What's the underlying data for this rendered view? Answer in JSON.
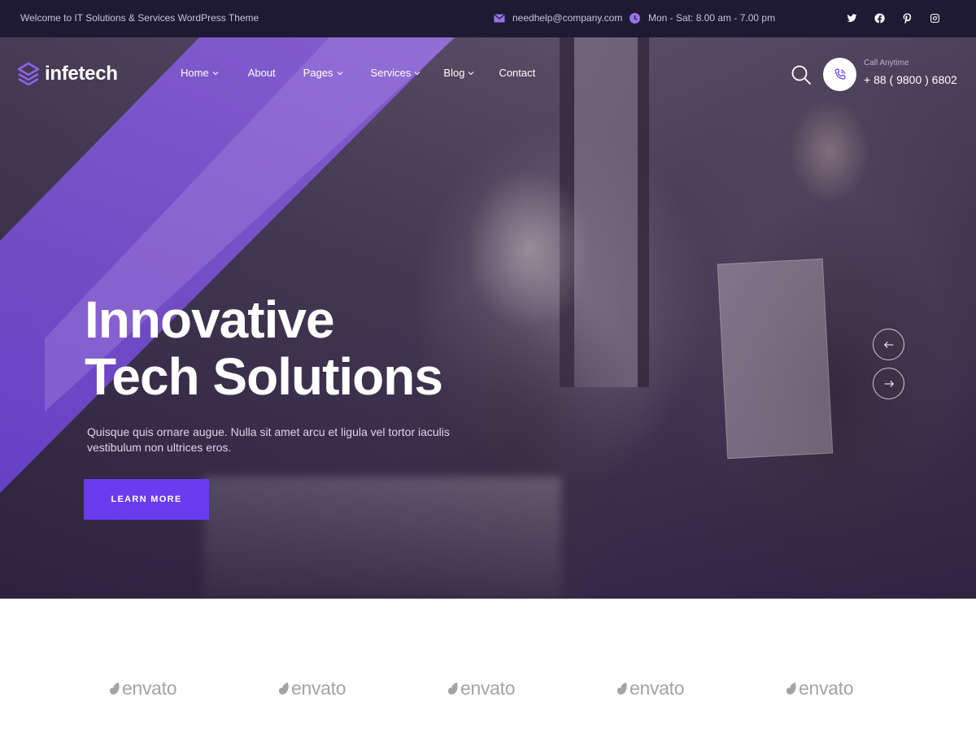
{
  "topbar": {
    "welcome": "Welcome to IT Solutions & Services WordPress Theme",
    "email": "needhelp@company.com",
    "hours": "Mon - Sat: 8.00 am - 7.00 pm",
    "socials": [
      "twitter-icon",
      "facebook-icon",
      "pinterest-icon",
      "instagram-icon"
    ]
  },
  "brand": {
    "name": "infetech",
    "accent": "#6a3cf0"
  },
  "nav": {
    "items": [
      {
        "label": "Home",
        "has_dropdown": true
      },
      {
        "label": "About",
        "has_dropdown": false
      },
      {
        "label": "Pages",
        "has_dropdown": true
      },
      {
        "label": "Services",
        "has_dropdown": true
      },
      {
        "label": "Blog",
        "has_dropdown": true
      },
      {
        "label": "Contact",
        "has_dropdown": false
      }
    ]
  },
  "call": {
    "label": "Call Anytime",
    "number": "+ 88 ( 9800 ) 6802"
  },
  "hero": {
    "title_line1": "Innovative",
    "title_line2": "Tech Solutions",
    "subtitle": "Quisque quis ornare augue. Nulla sit amet arcu et ligula vel tortor iaculis vestibulum non ultrices eros.",
    "cta": "LEARN MORE"
  },
  "partners": [
    "envato",
    "envato",
    "envato",
    "envato",
    "envato"
  ]
}
